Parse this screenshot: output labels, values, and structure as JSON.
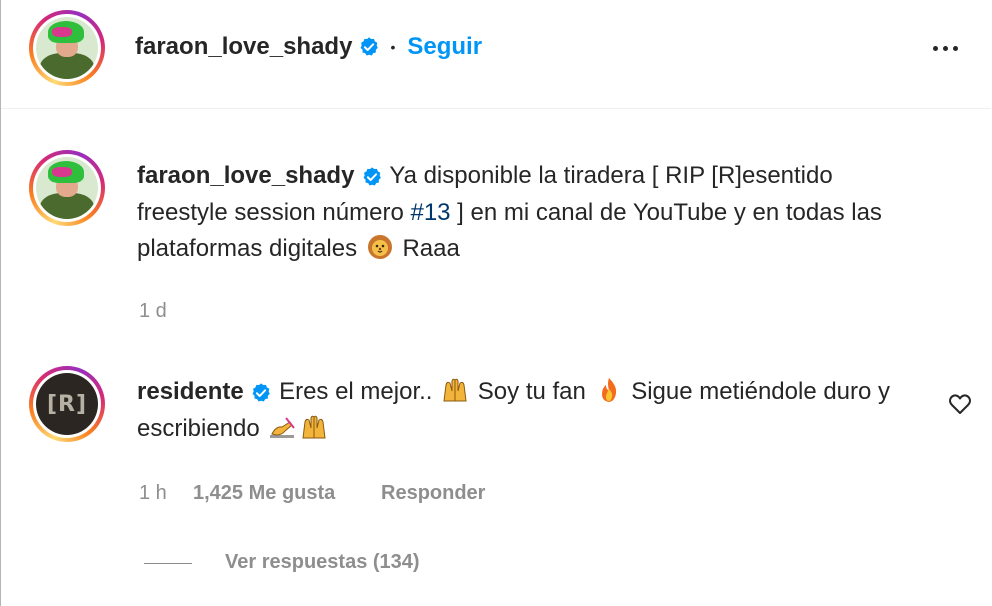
{
  "header": {
    "username": "faraon_love_shady",
    "separator": "•",
    "follow_label": "Seguir",
    "more_icon": "more-horizontal-icon"
  },
  "caption": {
    "username": "faraon_love_shady",
    "text_before_tag": "Ya disponible la tiradera [ RIP [R]esentido freestyle session número ",
    "hashtag": "#13",
    "text_after_tag": " ] en mi canal de YouTube y en todas las plataformas digitales ",
    "text_end": " Raaa",
    "emoji": "lion-face-emoji",
    "time": "1 d"
  },
  "comment": {
    "username": "residente",
    "avatar_text": "[R]",
    "part1": "Eres el mejor.. ",
    "part2": " Soy tu fan ",
    "part3": " Sigue metiéndole duro y escribiendo ",
    "emojis": [
      "raising-hands-emoji",
      "fire-emoji",
      "writing-hand-emoji",
      "raising-hands-emoji"
    ],
    "time": "1 h",
    "likes": "1,425 Me gusta",
    "reply_label": "Responder",
    "view_replies": "Ver respuestas (134)"
  },
  "colors": {
    "link_blue": "#0095f6",
    "hashtag": "#00376b",
    "muted": "#8e8e8e",
    "text": "#262626"
  }
}
